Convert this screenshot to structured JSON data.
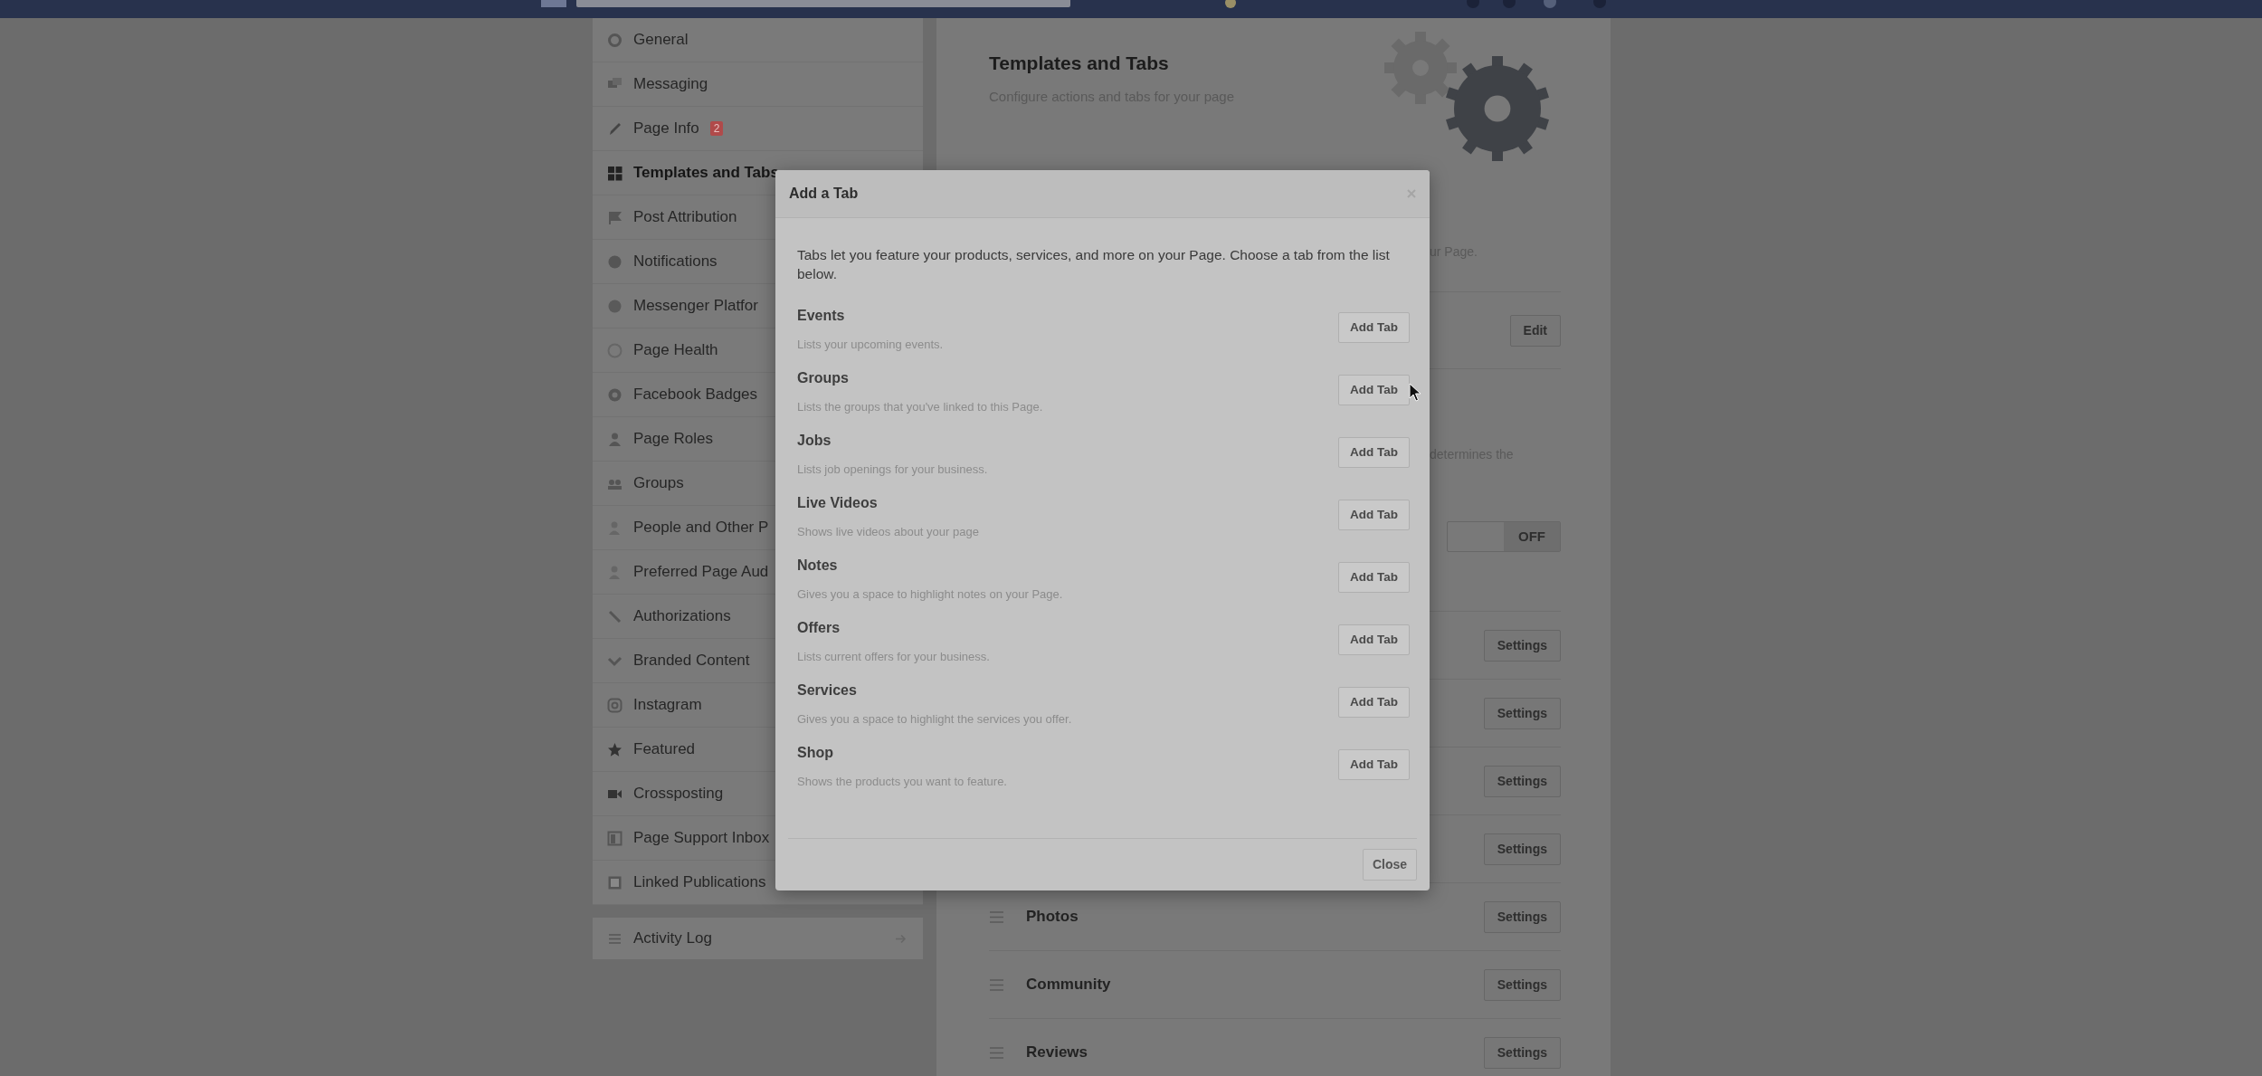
{
  "sidebar": {
    "items": [
      {
        "label": "General",
        "selected": false
      },
      {
        "label": "Messaging",
        "selected": false
      },
      {
        "label": "Page Info",
        "selected": false,
        "badge": "2"
      },
      {
        "label": "Templates and Tabs",
        "selected": true
      },
      {
        "label": "Post Attribution",
        "selected": false
      },
      {
        "label": "Notifications",
        "selected": false
      },
      {
        "label": "Messenger Platfor",
        "selected": false
      },
      {
        "label": "Page Health",
        "selected": false
      },
      {
        "label": "Facebook Badges",
        "selected": false
      },
      {
        "label": "Page Roles",
        "selected": false
      },
      {
        "label": "Groups",
        "selected": false
      },
      {
        "label": "People and Other P",
        "selected": false
      },
      {
        "label": "Preferred Page Aud",
        "selected": false
      },
      {
        "label": "Authorizations",
        "selected": false
      },
      {
        "label": "Branded Content",
        "selected": false
      },
      {
        "label": "Instagram",
        "selected": false
      },
      {
        "label": "Featured",
        "selected": false
      },
      {
        "label": "Crossposting",
        "selected": false
      },
      {
        "label": "Page Support Inbox",
        "selected": false
      },
      {
        "label": "Linked Publications",
        "selected": false
      }
    ],
    "activity_log": "Activity Log"
  },
  "main": {
    "title": "Templates and Tabs",
    "subtitle": "Configure actions and tabs for your page",
    "fragment_1": "ur Page.",
    "edit_button": "Edit",
    "fragment_2": "determines the",
    "toggle": {
      "label": "OFF",
      "on": false
    },
    "rows": [
      {
        "button": "Settings"
      },
      {
        "button": "Settings"
      },
      {
        "button": "Settings"
      },
      {
        "button": "Settings"
      },
      {
        "label": "Photos",
        "button": "Settings"
      },
      {
        "label": "Community",
        "button": "Settings"
      },
      {
        "label": "Reviews",
        "button": "Settings"
      }
    ]
  },
  "modal": {
    "title": "Add a Tab",
    "description": "Tabs let you feature your products, services, and more on your Page. Choose a tab from the list below.",
    "tabs": [
      {
        "name": "Events",
        "description": "Lists your upcoming events.",
        "button": "Add Tab"
      },
      {
        "name": "Groups",
        "description": "Lists the groups that you've linked to this Page.",
        "button": "Add Tab"
      },
      {
        "name": "Jobs",
        "description": "Lists job openings for your business.",
        "button": "Add Tab"
      },
      {
        "name": "Live Videos",
        "description": "Shows live videos about your page",
        "button": "Add Tab"
      },
      {
        "name": "Notes",
        "description": "Gives you a space to highlight notes on your Page.",
        "button": "Add Tab"
      },
      {
        "name": "Offers",
        "description": "Lists current offers for your business.",
        "button": "Add Tab"
      },
      {
        "name": "Services",
        "description": "Gives you a space to highlight the services you offer.",
        "button": "Add Tab"
      },
      {
        "name": "Shop",
        "description": "Shows the products you want to feature.",
        "button": "Add Tab"
      }
    ],
    "close_button": "Close"
  }
}
